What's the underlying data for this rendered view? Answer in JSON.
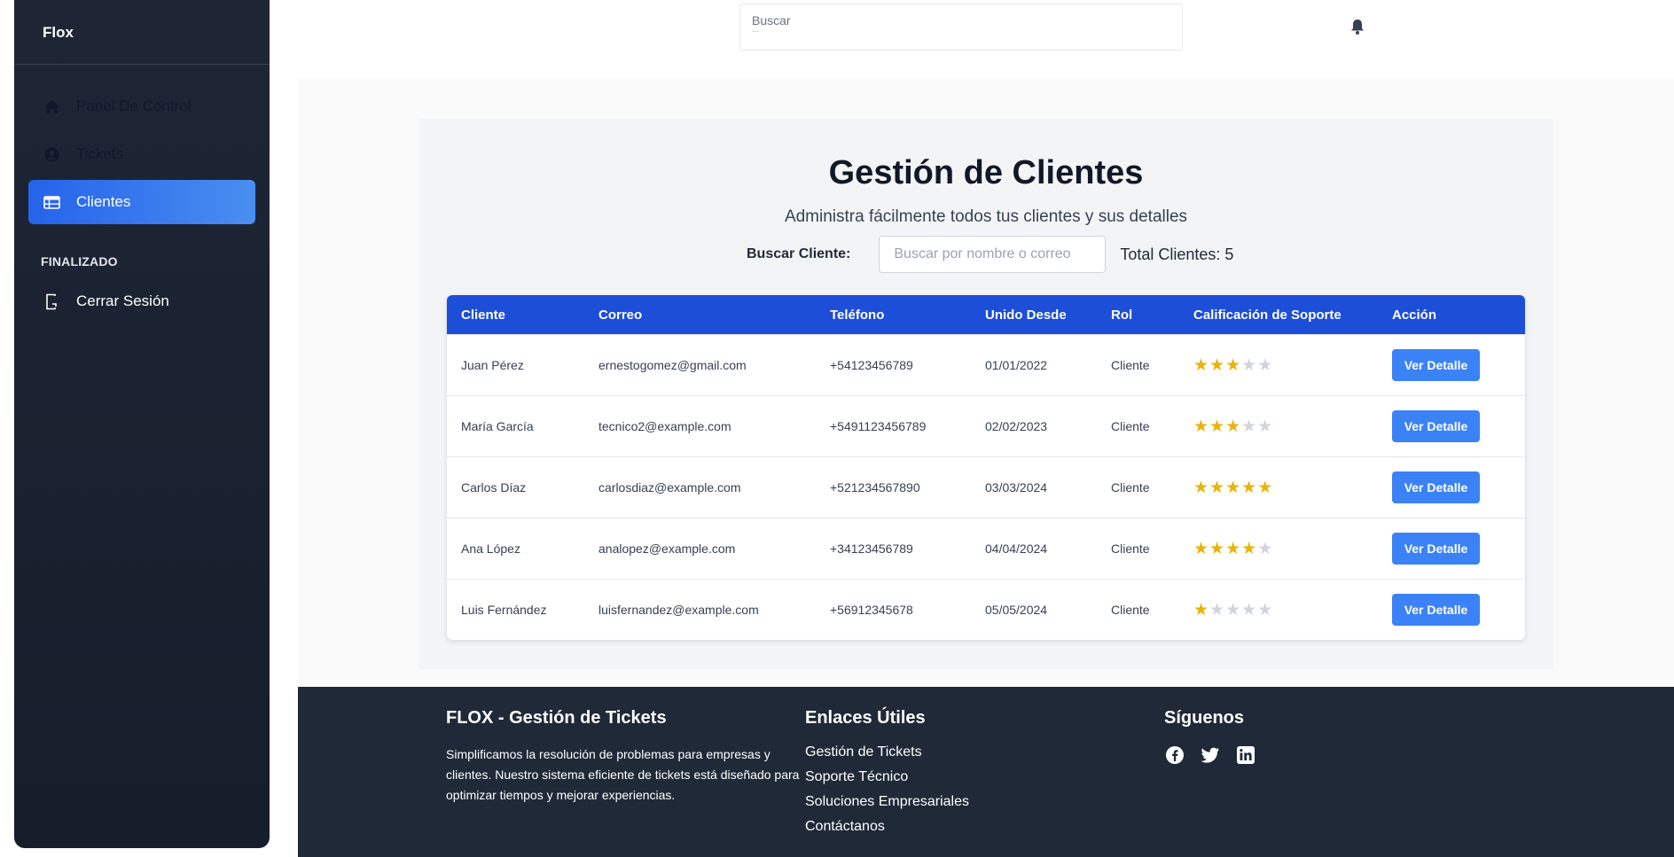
{
  "sidebar": {
    "brand": "Flox",
    "items": [
      {
        "label": "Panel De Control",
        "icon": "home-icon"
      },
      {
        "label": "Tickets",
        "icon": "user-circle-icon"
      },
      {
        "label": "Clientes",
        "icon": "table-icon"
      }
    ],
    "section_label": "FINALIZADO",
    "logout_label": "Cerrar Sesión"
  },
  "topbar": {
    "search_label": "Buscar",
    "search_dots": "..."
  },
  "main": {
    "title": "Gestión de Clientes",
    "subtitle": "Administra fácilmente todos tus clientes y sus detalles",
    "search_label": "Buscar Cliente:",
    "search_placeholder": "Buscar por nombre o correo",
    "total_label": "Total Clientes: 5"
  },
  "table": {
    "headers": [
      "Cliente",
      "Correo",
      "Teléfono",
      "Unido Desde",
      "Rol",
      "Calificación de Soporte",
      "Acción"
    ],
    "rows": [
      {
        "cliente": "Juan Pérez",
        "correo": "ernestogomez@gmail.com",
        "telefono": "+54123456789",
        "unido": "01/01/2022",
        "rol": "Cliente",
        "rating": 3,
        "accion": "Ver Detalle"
      },
      {
        "cliente": "María García",
        "correo": "tecnico2@example.com",
        "telefono": "+5491123456789",
        "unido": "02/02/2023",
        "rol": "Cliente",
        "rating": 3,
        "accion": "Ver Detalle"
      },
      {
        "cliente": "Carlos Díaz",
        "correo": "carlosdiaz@example.com",
        "telefono": "+521234567890",
        "unido": "03/03/2024",
        "rol": "Cliente",
        "rating": 5,
        "accion": "Ver Detalle"
      },
      {
        "cliente": "Ana López",
        "correo": "analopez@example.com",
        "telefono": "+34123456789",
        "unido": "04/04/2024",
        "rol": "Cliente",
        "rating": 4,
        "accion": "Ver Detalle"
      },
      {
        "cliente": "Luis Fernández",
        "correo": "luisfernandez@example.com",
        "telefono": "+56912345678",
        "unido": "05/05/2024",
        "rol": "Cliente",
        "rating": 1,
        "accion": "Ver Detalle"
      }
    ],
    "max_rating": 5
  },
  "footer": {
    "about_title": "FLOX - Gestión de Tickets",
    "about_text": "Simplificamos la resolución de problemas para empresas y clientes. Nuestro sistema eficiente de tickets está diseñado para optimizar tiempos y mejorar experiencias.",
    "links_title": "Enlaces Útiles",
    "links": [
      "Gestión de Tickets",
      "Soporte Técnico",
      "Soluciones Empresariales",
      "Contáctanos"
    ],
    "social_title": "Síguenos",
    "social": [
      "facebook-icon",
      "twitter-icon",
      "linkedin-icon"
    ]
  },
  "colors": {
    "accent": "#3b82f6",
    "header_blue": "#1d4ed8",
    "sidebar_bg": "#1e2636",
    "star": "#eab308"
  }
}
